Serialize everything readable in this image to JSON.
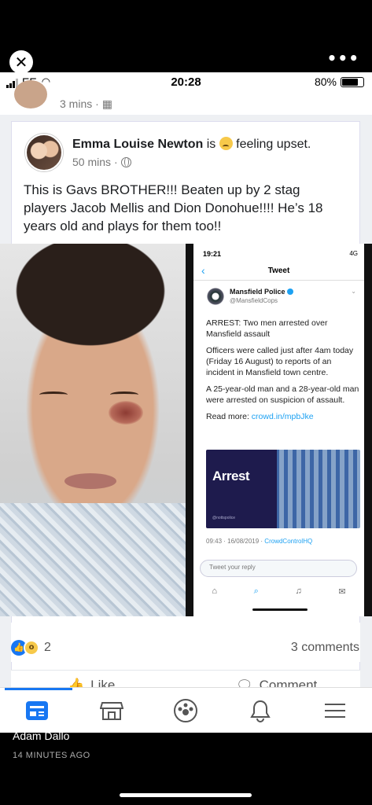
{
  "viewer": {
    "more_label": "•••"
  },
  "status_bar": {
    "carrier": "EE",
    "time": "20:28",
    "battery": "80%"
  },
  "previous_post": {
    "time": "3 mins"
  },
  "post": {
    "author": "Emma Louise Newton",
    "feeling_prefix": "is",
    "feeling": "feeling upset.",
    "time": "50 mins",
    "text": "This is Gavs BROTHER!!! Beaten up by 2 stag players Jacob Mellis and Dion Donohue!!!! He’s 18 years old and plays for them too!!",
    "reaction_count": "2",
    "comments": "3 comments",
    "like_label": "Like",
    "comment_label": "Comment"
  },
  "tweet_screenshot": {
    "status_time": "19:21",
    "status_network": "4G",
    "title": "Tweet",
    "account_name": "Mansfield Police",
    "account_handle": "@MansfieldCops",
    "paragraphs": [
      "ARREST: Two men arrested over Mansfield assault",
      "Officers were called just after 4am today (Friday 16 August) to reports of an incident in Mansfield town centre.",
      "A 25-year-old man and a 28-year-old man were arrested on suspicion of assault."
    ],
    "read_more_label": "Read more:",
    "read_more_link": "crowd.in/mpbJke",
    "card_text": "Arrest",
    "card_footer": "@nottspolice",
    "date": "09:43 · 16/08/2019 ·",
    "client": "CrowdControlHQ",
    "reply_placeholder": "Tweet your reply"
  },
  "notification": {
    "name": "Adam Dallo",
    "time": "14 MINUTES AGO"
  },
  "colors": {
    "facebook_blue": "#1877f2",
    "twitter_blue": "#1da1f2"
  }
}
